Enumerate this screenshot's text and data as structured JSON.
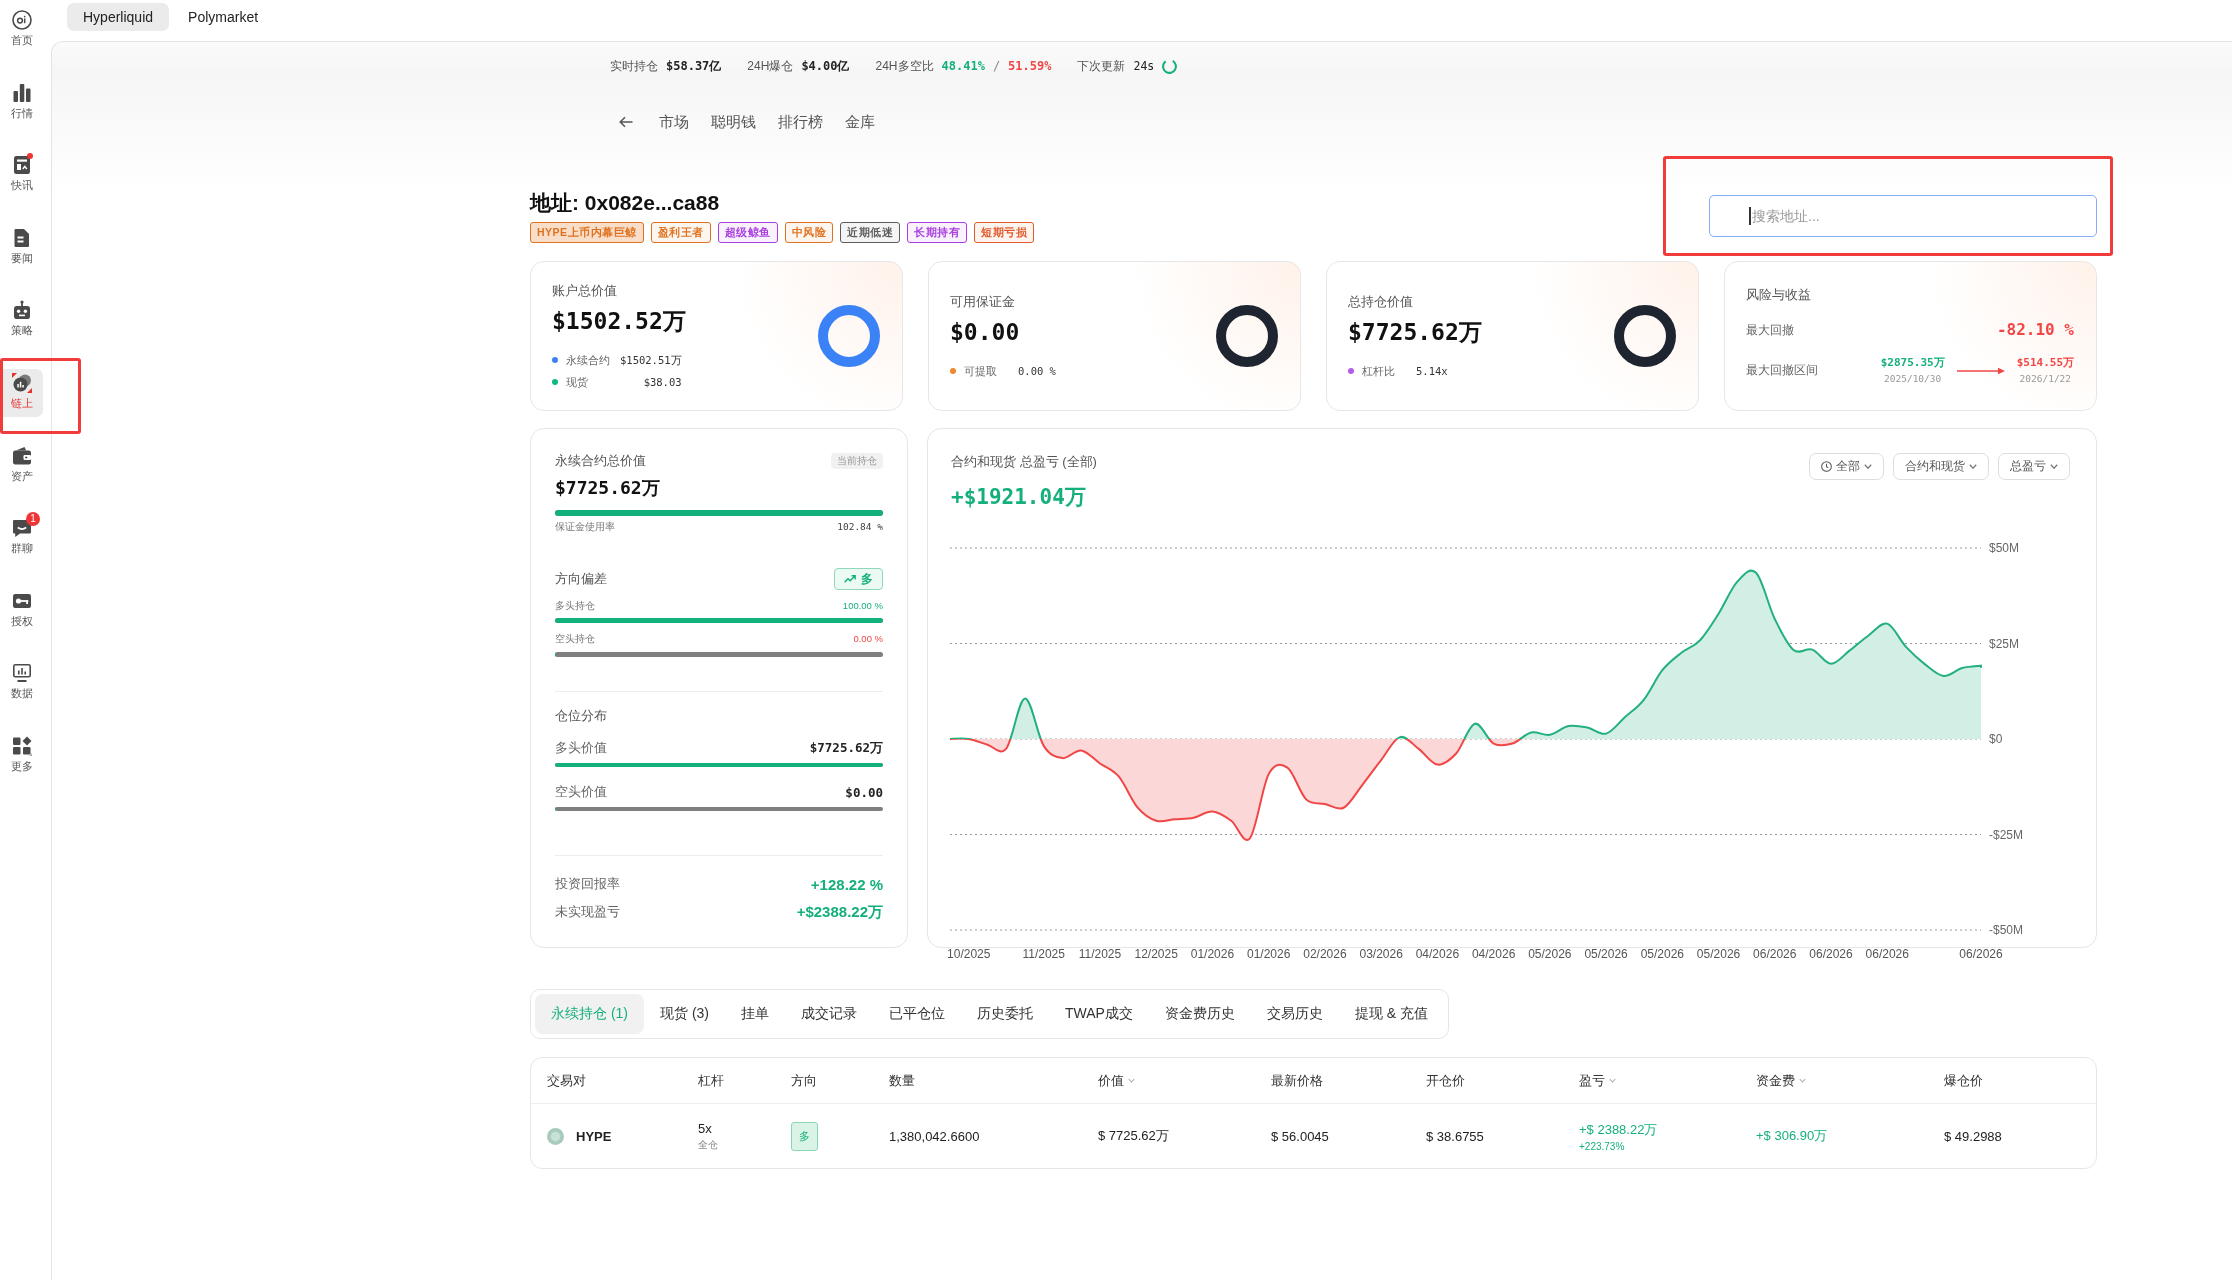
{
  "sidebar": {
    "items": [
      {
        "label": "首页",
        "selected": false,
        "dot": false,
        "outlined": false
      },
      {
        "label": "行情",
        "selected": false,
        "dot": false,
        "outlined": false
      },
      {
        "label": "快讯",
        "selected": false,
        "dot": true,
        "outlined": false
      },
      {
        "label": "要闻",
        "selected": false,
        "dot": false,
        "outlined": false
      },
      {
        "label": "策略",
        "selected": false,
        "dot": false,
        "outlined": false
      },
      {
        "label": "链上",
        "selected": true,
        "dot": false,
        "outlined": true
      },
      {
        "label": "资产",
        "selected": false,
        "dot": false,
        "outlined": false
      },
      {
        "label": "群聊",
        "selected": false,
        "dot": false,
        "outlined": false,
        "badge": "1"
      },
      {
        "label": "授权",
        "selected": false,
        "dot": false,
        "outlined": false
      },
      {
        "label": "数据",
        "selected": false,
        "dot": false,
        "outlined": false
      },
      {
        "label": "更多",
        "selected": false,
        "dot": false,
        "outlined": false
      }
    ]
  },
  "top_tabs": [
    {
      "label": "Hyperliquid",
      "selected": true
    },
    {
      "label": "Polymarket",
      "selected": false
    }
  ],
  "stats_bar": [
    {
      "kind": "value",
      "label": "实时持仓",
      "value": "$58.37亿"
    },
    {
      "kind": "value",
      "label": "24H爆仓",
      "value": "$4.00亿"
    },
    {
      "kind": "ratio",
      "label": "24H多空比",
      "long": "48.41%",
      "separator": "/",
      "short": "51.59%"
    },
    {
      "kind": "countdown",
      "label": "下次更新",
      "value": "24s"
    }
  ],
  "nav": {
    "items": [
      "市场",
      "聪明钱",
      "排行榜",
      "金库"
    ]
  },
  "address": {
    "title": "地址: 0x082e...ca88",
    "tags": [
      {
        "label": "HYPE上币内幕巨鲸",
        "color": "#e0721f",
        "strong": true
      },
      {
        "label": "盈利王者",
        "color": "#e0721f",
        "strong": false
      },
      {
        "label": "超级鲸鱼",
        "color": "#a93fe0",
        "strong": false
      },
      {
        "label": "中风险",
        "color": "#e0721f",
        "strong": false
      },
      {
        "label": "近期低迷",
        "color": "#5c5c5c",
        "strong": false
      },
      {
        "label": "长期持有",
        "color": "#a93fe0",
        "strong": false
      },
      {
        "label": "短期亏损",
        "color": "#e05b2b",
        "strong": false
      }
    ]
  },
  "search": {
    "placeholder": "搜索地址...",
    "focused": true,
    "outlined": true
  },
  "summary_cards": [
    {
      "kind": "breakdown",
      "title": "账户总价值",
      "value": "$1502.52万",
      "color": "#3b82f6",
      "legend": [
        {
          "label": "永续合约",
          "value": "$1502.51万",
          "color": "#3b82f6"
        },
        {
          "label": "现货",
          "value": "$38.03",
          "color": "#10b981"
        }
      ]
    },
    {
      "kind": "breakdown",
      "title": "可用保证金",
      "value": "$0.00",
      "color": "#1f2530",
      "legend": [
        {
          "label": "可提取",
          "value": "0.00 %",
          "color": "#f0892b"
        }
      ]
    },
    {
      "kind": "breakdown",
      "title": "总持仓价值",
      "value": "$7725.62万",
      "color": "#1f2530",
      "legend": [
        {
          "label": "杠杆比",
          "value": "5.14x",
          "color": "#b45ce8"
        }
      ]
    },
    {
      "kind": "risk",
      "title": "风险与收益",
      "drawdown": {
        "label": "最大回撤",
        "value": "-82.10 %",
        "positive": false
      },
      "range": {
        "label": "最大回撤区间",
        "from": {
          "value": "$2875.35万",
          "date": "2025/10/30"
        },
        "to": {
          "value": "$514.55万",
          "date": "2026/1/22"
        }
      }
    }
  ],
  "perp_panel": {
    "title": "永续合约总价值",
    "badge": "当前持仓",
    "value": "$7725.62万",
    "margin_usage": {
      "label": "保证金使用率",
      "reading": "102.84 %",
      "level": 1
    },
    "bias": {
      "title": "方向偏差",
      "badge": "多",
      "long": {
        "label": "多头持仓",
        "reading": "100.00 %",
        "level": 1
      },
      "short": {
        "label": "空头持仓",
        "reading": "0.00 %",
        "level": 0
      }
    },
    "distribution": {
      "title": "仓位分布",
      "long": {
        "label": "多头价值",
        "value": "$7725.62万",
        "level": 1
      },
      "short": {
        "label": "空头价值",
        "value": "$0.00",
        "level": 0
      }
    },
    "returns": [
      {
        "label": "投资回报率",
        "value": "+128.22 %",
        "positive": true
      },
      {
        "label": "未实现盈亏",
        "value": "+$2388.22万",
        "positive": true
      }
    ]
  },
  "pnl_panel": {
    "total": "+$1921.04万",
    "positive": true,
    "filters": [
      {
        "kind": "time",
        "label": "全部"
      },
      {
        "kind": "plain",
        "label": "合约和现货"
      },
      {
        "kind": "plain",
        "label": "总盈亏"
      }
    ],
    "chart_data": {
      "type": "area",
      "title": "合约和现货 总盈亏 (全部)",
      "categories": [
        null,
        "10/2025",
        null,
        null,
        null,
        "11/2025",
        null,
        null,
        "11/2025",
        null,
        null,
        "12/2025",
        null,
        null,
        "01/2026",
        null,
        null,
        "01/2026",
        null,
        null,
        "02/2026",
        null,
        null,
        "03/2026",
        null,
        null,
        "04/2026",
        null,
        null,
        "04/2026",
        null,
        null,
        "05/2026",
        null,
        null,
        "05/2026",
        null,
        null,
        "05/2026",
        null,
        null,
        "05/2026",
        null,
        null,
        "06/2026",
        null,
        null,
        "06/2026",
        null,
        null,
        "06/2026",
        null,
        null,
        null,
        null,
        "06/2026"
      ],
      "series": [
        {
          "color": "#22b07d",
          "values": [
            0,
            0,
            -1.5,
            -2.5,
            10.6,
            -1.8,
            -5,
            -3,
            -6.4,
            -9.8,
            -17.9,
            -21.4,
            -21,
            -20.6,
            -19,
            -21.4,
            -26,
            -9.2,
            -7.5,
            -15.8,
            -17,
            -18,
            -12,
            -5.5,
            0.5,
            -2.6,
            -6.7,
            -3.8,
            4,
            -1.2,
            -1.2,
            1.7,
            1.1,
            3.4,
            3,
            1.4,
            5.7,
            10.2,
            18,
            22.5,
            25.8,
            32.8,
            41.2,
            43.5,
            31.4,
            23.3,
            23.4,
            19.7,
            23.2,
            27.1,
            30.2,
            24.1,
            19.6,
            16.5,
            18.6,
            19.2
          ]
        }
      ],
      "ylim": [
        -50,
        50
      ],
      "yticks": [
        {
          "value": 50,
          "label": "$50M"
        },
        {
          "value": 25,
          "label": "$25M"
        },
        {
          "value": 0,
          "label": "$0"
        },
        {
          "value": -25,
          "label": "-$25M"
        },
        {
          "value": -50,
          "label": "-$50M"
        }
      ],
      "grid": true
    }
  },
  "position_tabs": [
    {
      "label": "永续持仓 (1)",
      "selected": true
    },
    {
      "label": "现货 (3)",
      "selected": false
    },
    {
      "label": "挂单",
      "selected": false
    },
    {
      "label": "成交记录",
      "selected": false
    },
    {
      "label": "已平仓位",
      "selected": false
    },
    {
      "label": "历史委托",
      "selected": false
    },
    {
      "label": "TWAP成交",
      "selected": false
    },
    {
      "label": "资金费历史",
      "selected": false
    },
    {
      "label": "交易历史",
      "selected": false
    },
    {
      "label": "提现 & 充值",
      "selected": false
    }
  ],
  "positions_table": {
    "columns": [
      {
        "label": "交易对",
        "sortable": false
      },
      {
        "label": "杠杆",
        "sortable": false
      },
      {
        "label": "方向",
        "sortable": false
      },
      {
        "label": "数量",
        "sortable": false
      },
      {
        "label": "价值",
        "sortable": true
      },
      {
        "label": "最新价格",
        "sortable": false
      },
      {
        "label": "开仓价",
        "sortable": false
      },
      {
        "label": "盈亏",
        "sortable": true
      },
      {
        "label": "资金费",
        "sortable": true
      },
      {
        "label": "爆仓价",
        "sortable": false
      }
    ],
    "rows": [
      {
        "pair": "HYPE",
        "leverage": "5x",
        "margin_mode": "全仓",
        "side": "多",
        "size": "1,380,042.6600",
        "value": "$ 7725.62万",
        "mark_price": "$ 56.0045",
        "entry_price": "$ 38.6755",
        "pnl": {
          "value": "+$ 2388.22万",
          "percent": "+223.73%",
          "positive": true
        },
        "funding": {
          "value": "+$ 306.90万",
          "positive": true
        },
        "liq_price": "$ 49.2988"
      }
    ]
  }
}
